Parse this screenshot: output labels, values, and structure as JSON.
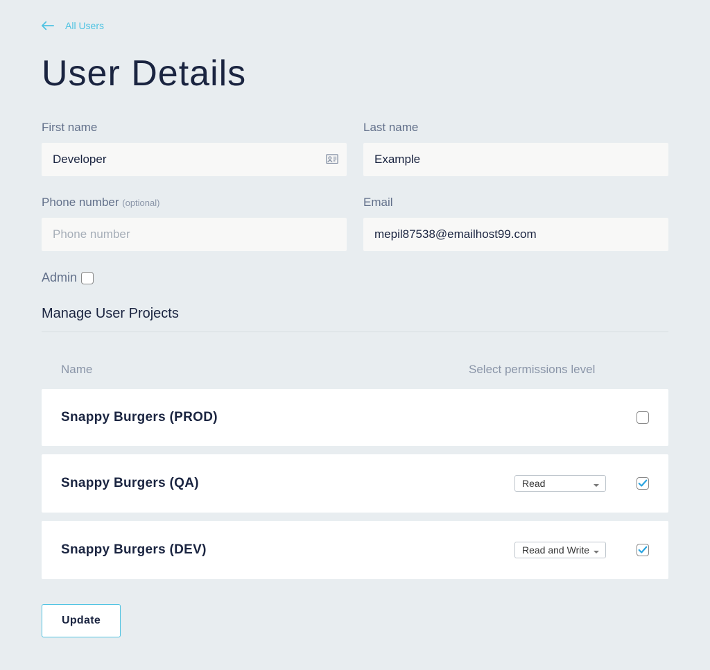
{
  "nav": {
    "back_label": "All Users"
  },
  "page": {
    "title": "User Details"
  },
  "form": {
    "first_name": {
      "label": "First name",
      "value": "Developer"
    },
    "last_name": {
      "label": "Last name",
      "value": "Example"
    },
    "phone": {
      "label": "Phone number",
      "optional": "(optional)",
      "placeholder": "Phone number",
      "value": ""
    },
    "email": {
      "label": "Email",
      "value": "mepil87538@emailhost99.com"
    },
    "admin": {
      "label": "Admin",
      "checked": false
    }
  },
  "projects": {
    "section_title": "Manage User Projects",
    "columns": {
      "name": "Name",
      "permissions": "Select permissions level"
    },
    "items": [
      {
        "name": "Snappy Burgers (PROD)",
        "permission": "",
        "enabled": false
      },
      {
        "name": "Snappy Burgers (QA)",
        "permission": "Read",
        "enabled": true
      },
      {
        "name": "Snappy Burgers (DEV)",
        "permission": "Read and Write",
        "enabled": true
      }
    ]
  },
  "actions": {
    "update_label": "Update"
  }
}
